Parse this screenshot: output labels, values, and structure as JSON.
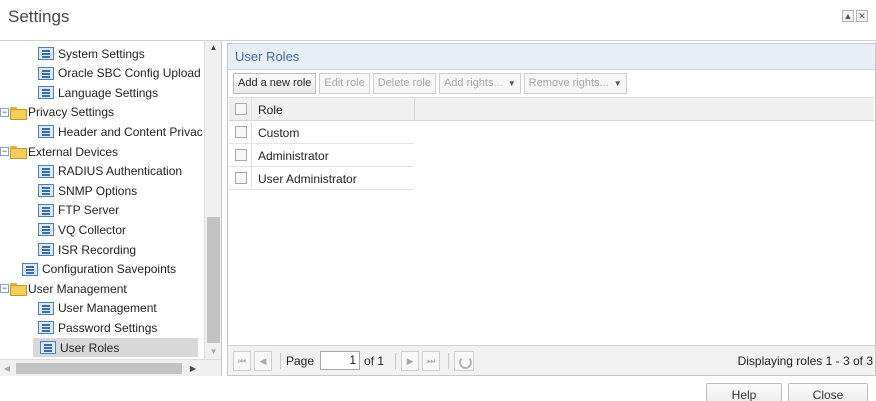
{
  "window": {
    "title": "Settings",
    "max_glyph": "▲",
    "close_glyph": "✕"
  },
  "tree": {
    "items": [
      {
        "label": "System Settings",
        "type": "leaf",
        "indent": 2
      },
      {
        "label": "Oracle SBC Config Upload",
        "type": "leaf",
        "indent": 2
      },
      {
        "label": "Language Settings",
        "type": "leaf",
        "indent": 2
      },
      {
        "label": "Privacy Settings",
        "type": "folder",
        "indent": 0
      },
      {
        "label": "Header and Content Privac",
        "type": "leaf",
        "indent": 2
      },
      {
        "label": "External Devices",
        "type": "folder",
        "indent": 0
      },
      {
        "label": "RADIUS Authentication",
        "type": "leaf",
        "indent": 2
      },
      {
        "label": "SNMP Options",
        "type": "leaf",
        "indent": 2
      },
      {
        "label": "FTP Server",
        "type": "leaf",
        "indent": 2
      },
      {
        "label": "VQ Collector",
        "type": "leaf",
        "indent": 2
      },
      {
        "label": "ISR Recording",
        "type": "leaf",
        "indent": 2
      },
      {
        "label": "Configuration Savepoints",
        "type": "leaf",
        "indent": 1
      },
      {
        "label": "User Management",
        "type": "folder",
        "indent": 0
      },
      {
        "label": "User Management",
        "type": "leaf",
        "indent": 2
      },
      {
        "label": "Password Settings",
        "type": "leaf",
        "indent": 2
      },
      {
        "label": "User Roles",
        "type": "leaf",
        "indent": 2,
        "selected": true
      }
    ],
    "expander_glyph": "−",
    "scroll_up": "▲",
    "scroll_down": "▼",
    "scroll_left": "◀",
    "scroll_right": "▶"
  },
  "panel": {
    "title": "User Roles",
    "toolbar": {
      "add_role": "Add a new role",
      "edit_role": "Edit role",
      "delete_role": "Delete role",
      "add_rights": "Add rights...",
      "remove_rights": "Remove rights...",
      "caret": "▼"
    },
    "grid": {
      "column_role": "Role",
      "rows": [
        "Custom",
        "Administrator",
        "User Administrator"
      ]
    },
    "pager": {
      "first": "⏮",
      "prev": "◀",
      "page_label": "Page",
      "page_value": "1",
      "of_label": "of 1",
      "next": "▶",
      "last": "⏭",
      "status": "Displaying roles 1 - 3 of 3"
    }
  },
  "footer": {
    "help": "Help",
    "close": "Close"
  },
  "colors": {
    "accent": "#3b6fa8",
    "panel_header_bg": "#e8eef6",
    "selected_bg": "#d8d8d8"
  }
}
